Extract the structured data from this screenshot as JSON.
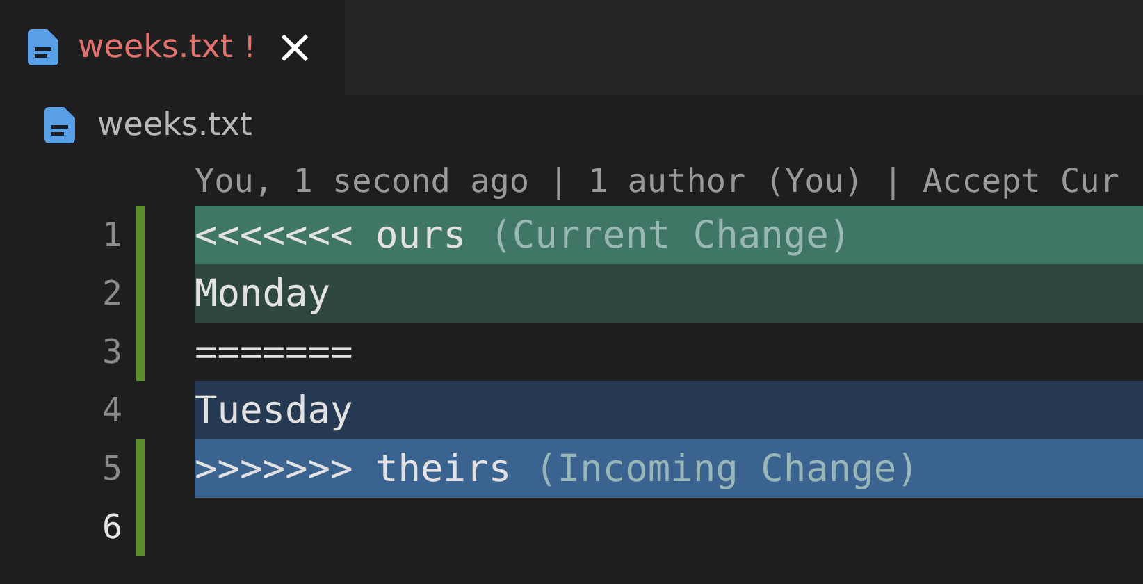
{
  "tabs": [
    {
      "label": "weeks.txt",
      "badge": "!",
      "selected": true,
      "close": "×"
    }
  ],
  "breadcrumb": {
    "label": "weeks.txt"
  },
  "codelens": "You, 1 second ago | 1 author (You) | Accept Cur",
  "lines": [
    {
      "number": "1",
      "kind": "current-marker",
      "text": "<<<<<<< ours",
      "note": "(Current Change)",
      "modified": true,
      "active": false
    },
    {
      "number": "2",
      "kind": "current",
      "text": "Monday",
      "modified": true,
      "active": false
    },
    {
      "number": "3",
      "kind": "plain",
      "text": "=======",
      "modified": true,
      "active": false
    },
    {
      "number": "4",
      "kind": "incoming",
      "text": "Tuesday",
      "modified": false,
      "active": false
    },
    {
      "number": "5",
      "kind": "incoming-marker",
      "text": ">>>>>>> theirs",
      "note": "(Incoming Change)",
      "modified": true,
      "active": false
    },
    {
      "number": "6",
      "kind": "plain",
      "modified": true,
      "active": true
    }
  ]
}
